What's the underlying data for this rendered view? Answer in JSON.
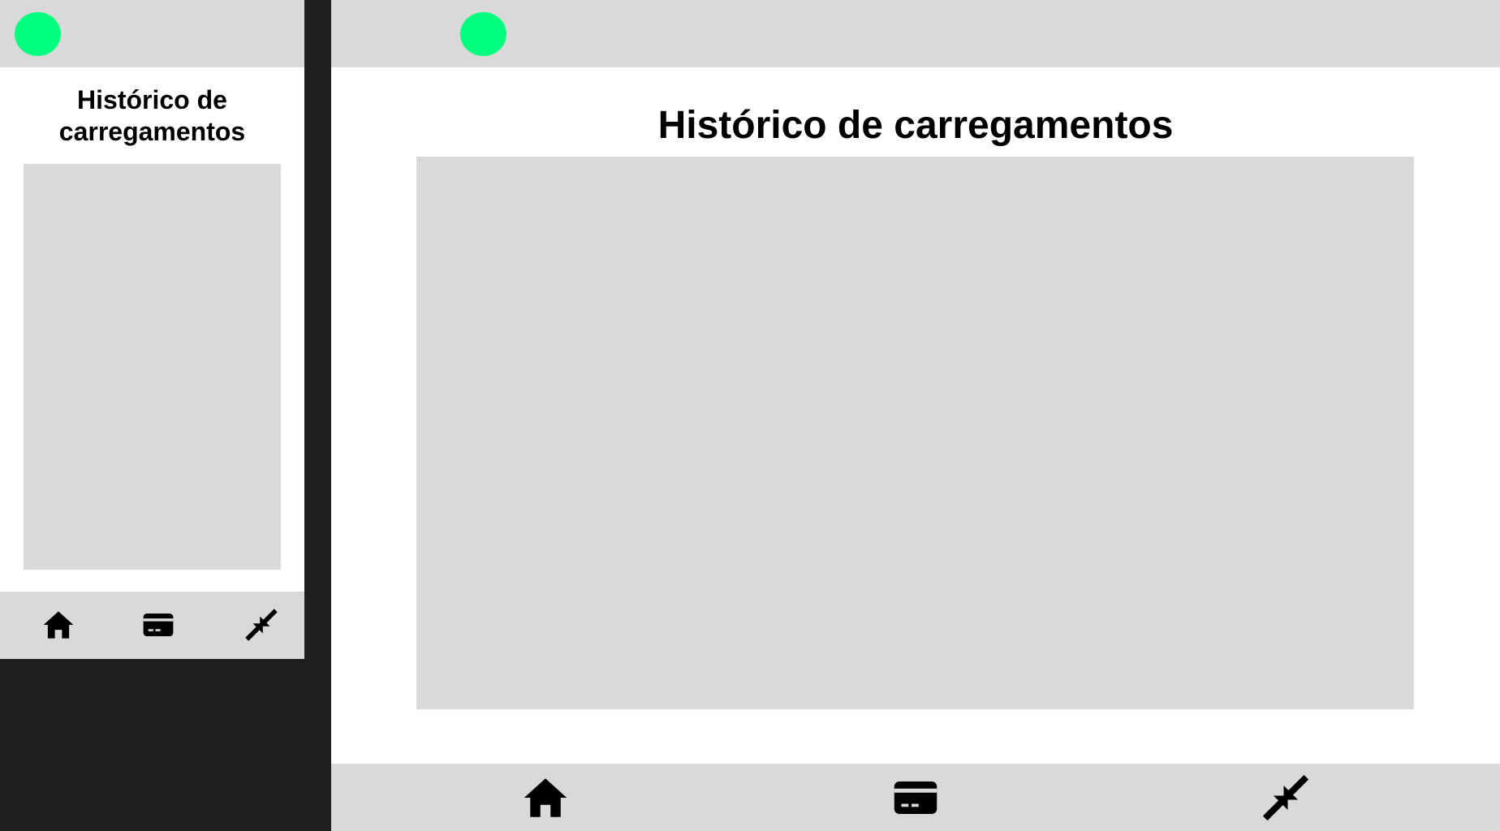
{
  "colors": {
    "canvas_background": "#1e1e1e",
    "frame_background": "#ffffff",
    "bar_background": "#d9d9d9",
    "placeholder_background": "#d9d9d9",
    "logo_accent": "#00ff7f",
    "icon_color": "#000000",
    "text_color": "#000000"
  },
  "mobile": {
    "logo_icon": "logo-circle-icon",
    "title": "Histórico de carregamentos",
    "nav": [
      {
        "name": "home",
        "icon": "home-icon"
      },
      {
        "name": "card",
        "icon": "credit-card-icon"
      },
      {
        "name": "minimize",
        "icon": "minimize-arrows-icon"
      }
    ]
  },
  "desktop": {
    "logo_icon": "logo-circle-icon",
    "title": "Histórico de carregamentos",
    "nav": [
      {
        "name": "home",
        "icon": "home-icon"
      },
      {
        "name": "card",
        "icon": "credit-card-icon"
      },
      {
        "name": "minimize",
        "icon": "minimize-arrows-icon"
      }
    ]
  }
}
